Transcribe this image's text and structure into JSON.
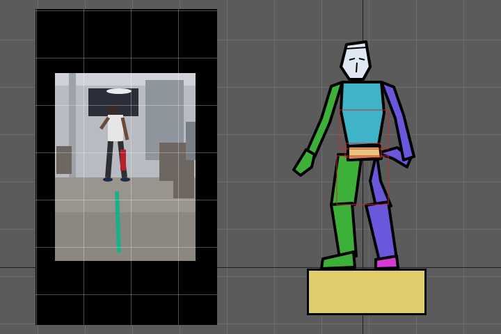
{
  "scene": {
    "background_color": "#5b5b5b",
    "pedestal_color": "#dfcc6a",
    "video_trail_color": "#19b089"
  },
  "avatar": {
    "segment_colors": {
      "head": "#dde8f2",
      "torso": "#3fb4c9",
      "hips": "#e8c47c",
      "left_side": "#3cb039",
      "right_side": "#6a58dc",
      "feet_accent": "#d63ad0"
    }
  }
}
